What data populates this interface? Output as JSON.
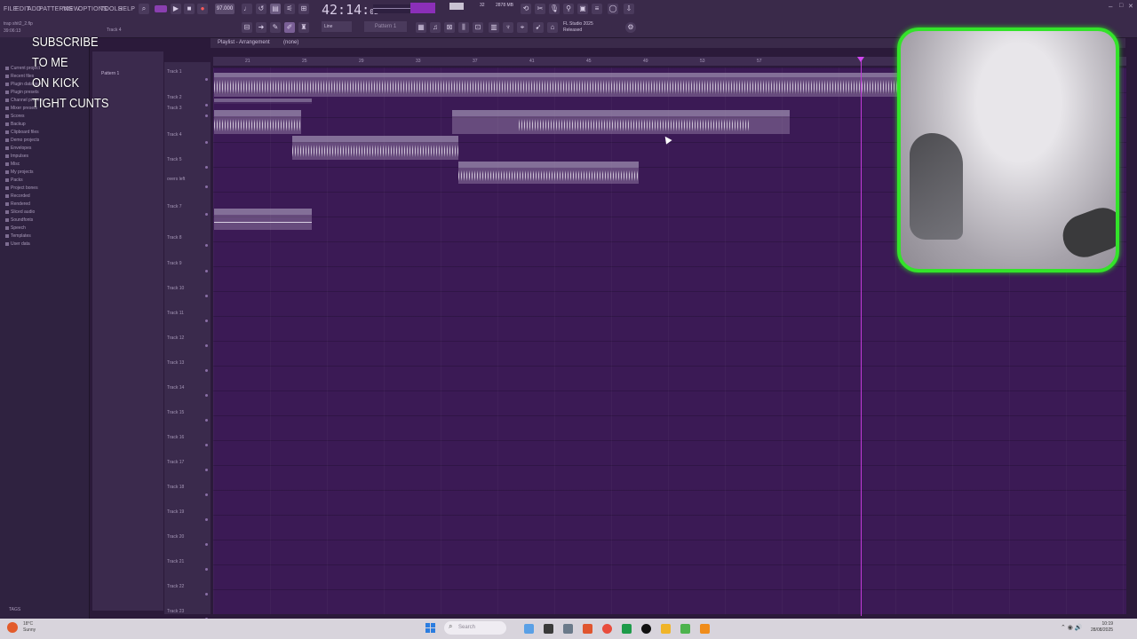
{
  "app": {
    "title": "trap shit2_2.flp",
    "elapsed": "39:06:13",
    "version_line1": "FL Studio 2025",
    "version_line2": "Released"
  },
  "menu": [
    "FILE",
    "EDIT",
    "ADD",
    "PATTERNS",
    "VIEW",
    "OPTIONS",
    "TOOLS",
    "HELP"
  ],
  "transport": {
    "tempo": "97.000",
    "time_main": "42:14",
    "time_sub": "02",
    "cpu": "32",
    "memory": "2878 MB",
    "current_track": "Track 4",
    "snap": "Line",
    "pattern": "Pattern 1"
  },
  "browser": {
    "items": [
      "Current project",
      "Recent files",
      "Plugin database",
      "Plugin presets",
      "Channel presets",
      "Mixer presets",
      "Scores",
      "Backup",
      "Clipboard files",
      "Demo projects",
      "Envelopes",
      "Impulses",
      "Misc",
      "My projects",
      "Packs",
      "Project bones",
      "Recorded",
      "Rendered",
      "Sliced audio",
      "Soundfonts",
      "Speech",
      "Templates",
      "User data"
    ],
    "tags_label": "TAGS"
  },
  "playlist": {
    "title": "Playlist - Arrangement",
    "arrangement": "(none)",
    "pattern_item": "Pattern 1",
    "ruler": [
      "21",
      "25",
      "29",
      "33",
      "37",
      "41",
      "45",
      "49",
      "53",
      "57"
    ],
    "tracks": [
      "Track 1",
      "Track 2",
      "Track 3",
      "Track 4",
      "Track 5",
      "overs left",
      "Track 7",
      "Track 8",
      "Track 9",
      "Track 10",
      "Track 11",
      "Track 12",
      "Track 13",
      "Track 14",
      "Track 15",
      "Track 16",
      "Track 17",
      "Track 18",
      "Track 19",
      "Track 20",
      "Track 21",
      "Track 22",
      "Track 23"
    ],
    "clips": [
      {
        "label": "master_20251102_mp3"
      },
      {
        "label": "ringtone_2025-07-01 21-22-53_801"
      },
      {
        "label": "stolen beat off yo..."
      },
      {
        "label": "trap shit2_1_2025-08-19 21-21_801"
      },
      {
        "label": "stolen beat off youtube_1_2025-07-21 21-15-53_801"
      },
      {
        "label": "stolen beat off yout...2025-07-21 21-15-15_801"
      },
      {
        "label": "trap shit2_2025-07-27 05-18-07_801"
      }
    ]
  },
  "overlay": {
    "line1": "SUBSCRIBE",
    "line2": "TO ME",
    "line3": "ON KICK",
    "line4": "TIGHT CUNTS"
  },
  "taskbar": {
    "search": "Search",
    "time": "10:19",
    "date": "28/08/2025",
    "weather_temp": "18°C",
    "weather_desc": "Sunny"
  },
  "colors": {
    "accent": "#c03bd8",
    "webcam_border": "#33e32a",
    "playlist_bg": "#3b1a55"
  }
}
